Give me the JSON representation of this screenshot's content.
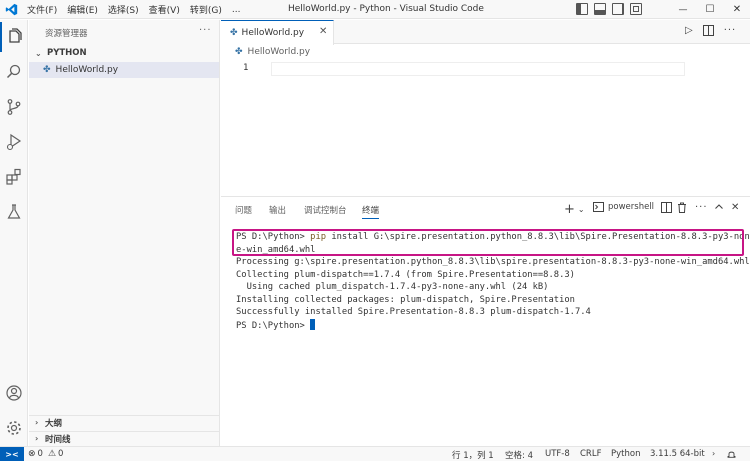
{
  "titlebar": {
    "menus": [
      "文件(F)",
      "编辑(E)",
      "选择(S)",
      "查看(V)",
      "转到(G)",
      "..."
    ],
    "title": "HelloWorld.py - Python - Visual Studio Code",
    "controls": {
      "minimize": "—",
      "maximize": "☐",
      "close": "✕"
    }
  },
  "activity_bar": {
    "items": [
      "explorer",
      "search",
      "source-control",
      "run-debug",
      "extensions",
      "testing"
    ],
    "bottom": [
      "accounts",
      "manage"
    ]
  },
  "sidebar": {
    "title": "资源管理器",
    "more": "···",
    "folder": "PYTHON",
    "files": [
      "HelloWorld.py"
    ],
    "outline_label": "大纲",
    "timeline_label": "时间线"
  },
  "editor": {
    "tab_label": "HelloWorld.py",
    "breadcrumb": "HelloWorld.py",
    "line_number": "1",
    "actions": {
      "run": "▷",
      "more": "···"
    }
  },
  "panel": {
    "tabs": [
      "问题",
      "输出",
      "调试控制台",
      "终端"
    ],
    "active_tab": "终端",
    "shell_name": "powershell",
    "terminal": {
      "line1_prompt": "PS D:\\Python> ",
      "line1_cmd": "pip",
      "line1_rest": " install G:\\spire.presentation.python_8.8.3\\lib\\Spire.Presentation-8.8.3-py3-non",
      "line2": "e-win_amd64.whl",
      "lines": [
        "Processing g:\\spire.presentation.python_8.8.3\\lib\\spire.presentation-8.8.3-py3-none-win_amd64.whl",
        "Collecting plum-dispatch==1.7.4 (from Spire.Presentation==8.8.3)",
        "  Using cached plum_dispatch-1.7.4-py3-none-any.whl (24 kB)",
        "Installing collected packages: plum-dispatch, Spire.Presentation",
        "Successfully installed Spire.Presentation-8.8.3 plum-dispatch-1.7.4"
      ],
      "final_prompt": "PS D:\\Python> "
    }
  },
  "statusbar": {
    "errors": "0",
    "warnings": "0",
    "position": "行 1，列 1",
    "spaces": "空格: 4",
    "encoding": "UTF-8",
    "eol": "CRLF",
    "language": "Python",
    "interpreter": "3.11.5 64-bit"
  },
  "colors": {
    "accent": "#005fb8",
    "highlight_box": "#c71585",
    "python_icon": "#3572a5"
  }
}
